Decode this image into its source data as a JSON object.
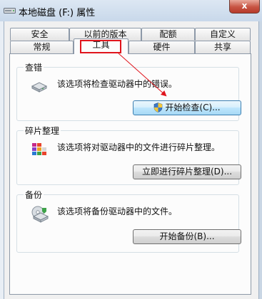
{
  "window": {
    "title": "本地磁盘 (F:) 属性",
    "close_label": "x"
  },
  "tabs_row1": [
    {
      "label": "安全"
    },
    {
      "label": "以前的版本"
    },
    {
      "label": "配额"
    },
    {
      "label": "自定义"
    }
  ],
  "tabs_row2": [
    {
      "label": "常规"
    },
    {
      "label": "工具",
      "active": true
    },
    {
      "label": "硬件"
    },
    {
      "label": "共享"
    }
  ],
  "groups": {
    "check": {
      "title": "查错",
      "description": "该选项将检查驱动器中的错误。",
      "button": "开始检查(C)...",
      "icon": "hard-drive-check-icon"
    },
    "defrag": {
      "title": "碎片整理",
      "description": "该选项将对驱动器中的文件进行碎片整理。",
      "button": "立即进行碎片整理(D)...",
      "icon": "defragment-icon"
    },
    "backup": {
      "title": "备份",
      "description": "该选项将备份驱动器中的文件。",
      "button": "开始备份(B)...",
      "icon": "backup-icon"
    }
  },
  "colors": {
    "annotation": "#e0141c",
    "title_bar": "#c8d8ea",
    "close_button": "#c75443"
  }
}
